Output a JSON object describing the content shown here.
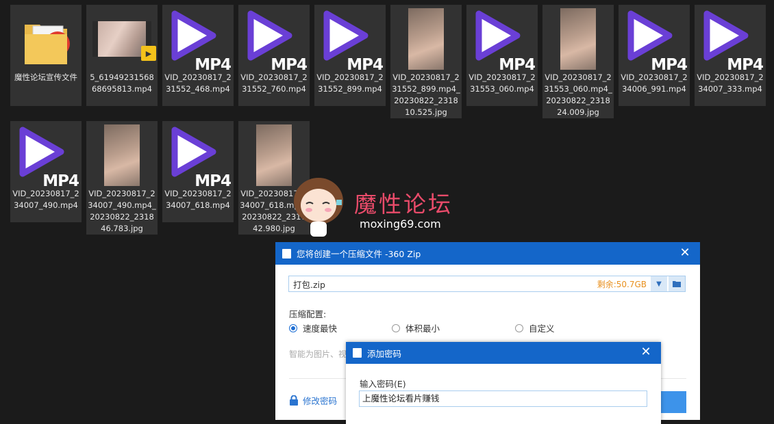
{
  "files": [
    {
      "name": "魔性论坛宣传文件",
      "type": "folder"
    },
    {
      "name": "5_6194923156868695813.mp4",
      "type": "video-thumb"
    },
    {
      "name": "VID_20230817_231552_468.mp4",
      "type": "mp4"
    },
    {
      "name": "VID_20230817_231552_760.mp4",
      "type": "mp4"
    },
    {
      "name": "VID_20230817_231552_899.mp4",
      "type": "mp4"
    },
    {
      "name": "VID_20230817_231552_899.mp4_20230822_231810.525.jpg",
      "type": "jpg"
    },
    {
      "name": "VID_20230817_231553_060.mp4",
      "type": "mp4"
    },
    {
      "name": "VID_20230817_231553_060.mp4_20230822_231824.009.jpg",
      "type": "jpg"
    },
    {
      "name": "VID_20230817_234006_991.mp4",
      "type": "mp4"
    },
    {
      "name": "VID_20230817_234007_333.mp4",
      "type": "mp4"
    },
    {
      "name": "VID_20230817_234007_490.mp4",
      "type": "mp4"
    },
    {
      "name": "VID_20230817_234007_490.mp4_20230822_231846.783.jpg",
      "type": "jpg"
    },
    {
      "name": "VID_20230817_234007_618.mp4",
      "type": "mp4"
    },
    {
      "name": "VID_20230817_234007_618.mp4_20230822_231742.980.jpg",
      "type": "jpg"
    }
  ],
  "mp4_label": "MP4",
  "player_badge": "Player",
  "watermark": {
    "title": "魔性论坛",
    "site": "moxing69.com"
  },
  "zip_dialog": {
    "title": "您将创建一个压缩文件 -360 Zip",
    "path": "打包.zip",
    "free_space": "剩余:50.7GB",
    "config_label": "压缩配置:",
    "options": [
      {
        "label": "速度最快",
        "selected": true
      },
      {
        "label": "体积最小",
        "selected": false
      },
      {
        "label": "自定义",
        "selected": false
      }
    ],
    "hint": "智能为图片、视",
    "modify_password": "修改密码"
  },
  "password_dialog": {
    "title": "添加密码",
    "label": "输入密码(E)",
    "value": "上魔性论坛看片赚钱"
  },
  "colors": {
    "accent": "#1466c9",
    "mp4_purple": "#6a3fd6",
    "watermark": "#e94b6a",
    "free_space": "#e8901e"
  }
}
